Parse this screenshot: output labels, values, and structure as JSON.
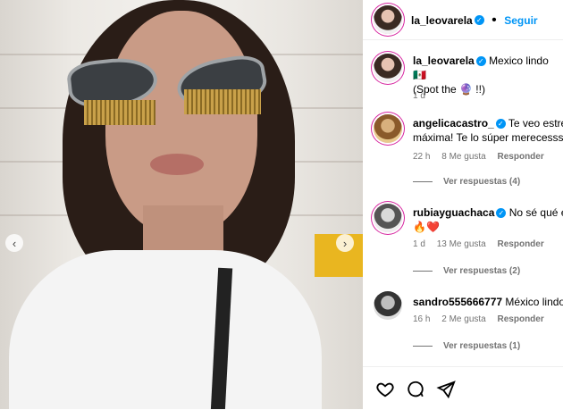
{
  "post": {
    "author": "la_leovarela",
    "follow_label": "Seguir",
    "caption_author": "la_leovarela",
    "caption_text": "Mexico lindo 🇲🇽",
    "caption_line2": "(Spot the 🔮 !!)",
    "caption_time": "1 d"
  },
  "comments": [
    {
      "user": "angelicacastro_",
      "text": "Te veo estresa",
      "text2": "máxima! Te lo súper merecesss !",
      "time": "22 h",
      "likes": "8 Me gusta",
      "reply": "Responder",
      "replies": "Ver respuestas (4)"
    },
    {
      "user": "rubiayguachaca",
      "text": "No sé qué es",
      "text2": "🔥❤️",
      "time": "1 d",
      "likes": "13 Me gusta",
      "reply": "Responder",
      "replies": "Ver respuestas (2)"
    },
    {
      "user": "sandro555666777",
      "text": "México lindo",
      "time": "16 h",
      "likes": "2 Me gusta",
      "reply": "Responder",
      "replies": "Ver respuestas (1)"
    }
  ],
  "colors": {
    "accent": "#0095f6",
    "muted": "#737373"
  },
  "icons": {
    "like": "heart-outline-icon",
    "comment": "comment-bubble-icon",
    "share": "paper-plane-icon"
  }
}
